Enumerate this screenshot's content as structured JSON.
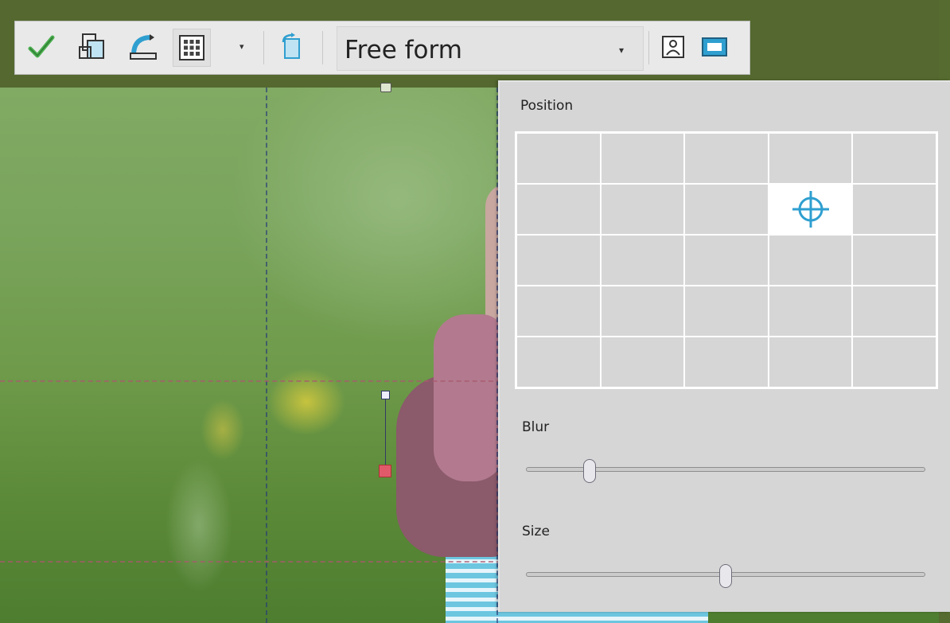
{
  "toolbar": {
    "buttons": [
      {
        "name": "apply-icon"
      },
      {
        "name": "crop-selection-icon"
      },
      {
        "name": "straighten-icon"
      },
      {
        "name": "grid-overlay-icon"
      },
      {
        "name": "grid-options-dropdown"
      },
      {
        "name": "rotate-crop-icon"
      },
      {
        "name": "portrait-orientation-icon"
      },
      {
        "name": "landscape-orientation-icon"
      }
    ],
    "aspect_ratio": "Free form",
    "accent": "#2f9fd0",
    "check_color": "#4caf50"
  },
  "panel": {
    "position_label": "Position",
    "blur_label": "Blur",
    "size_label": "Size",
    "grid": {
      "rows": 5,
      "cols": 5,
      "selected_row": 2,
      "selected_col": 4
    },
    "blur_value": 0.16,
    "size_value": 0.5,
    "target_icon": "crosshair-icon"
  }
}
